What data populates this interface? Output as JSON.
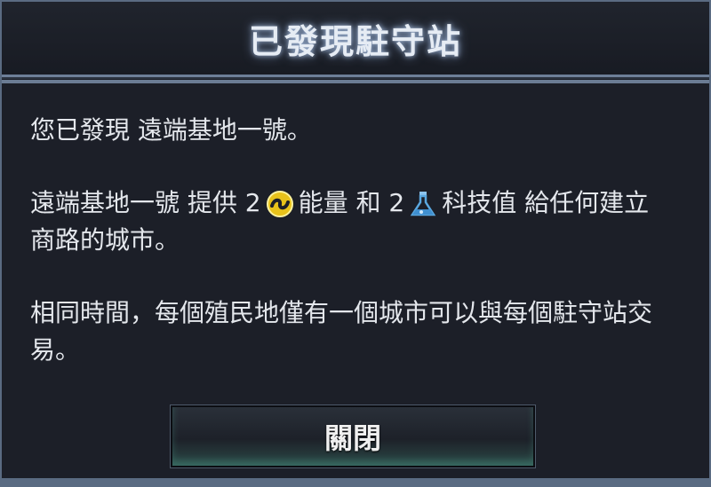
{
  "dialog": {
    "title": "已發現駐守站",
    "line1": "您已發現 遠端基地一號。",
    "line2_a": "遠端基地一號 提供 2",
    "line2_b": "能量 和 2",
    "line2_c": "科技值 給任何建立商路的城市。",
    "line3": "相同時間，每個殖民地僅有一個城市可以與每個駐守站交易。",
    "close_label": "關閉",
    "icons": {
      "energy": "energy-icon",
      "science": "science-flask-icon"
    },
    "colors": {
      "energy": "#e8c21a",
      "science": "#5aa8e0",
      "background": "#1c1f28"
    }
  }
}
